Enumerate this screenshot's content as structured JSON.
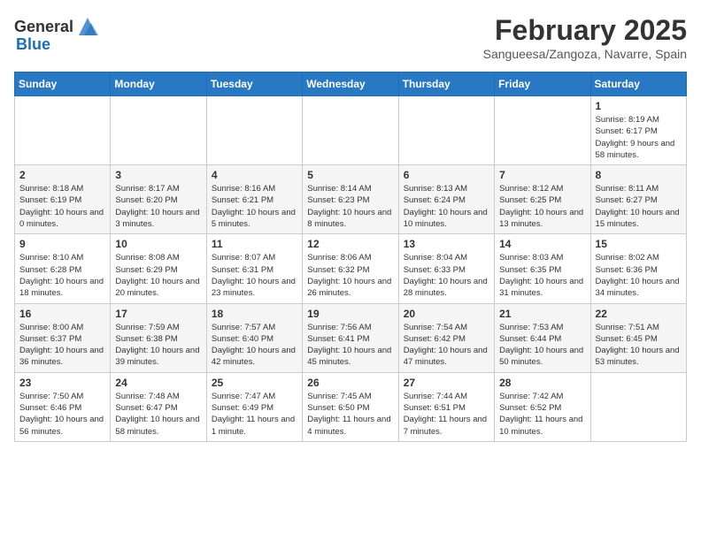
{
  "header": {
    "logo_general": "General",
    "logo_blue": "Blue",
    "title": "February 2025",
    "subtitle": "Sangueesa/Zangoza, Navarre, Spain"
  },
  "weekdays": [
    "Sunday",
    "Monday",
    "Tuesday",
    "Wednesday",
    "Thursday",
    "Friday",
    "Saturday"
  ],
  "weeks": [
    [
      {
        "day": "",
        "info": ""
      },
      {
        "day": "",
        "info": ""
      },
      {
        "day": "",
        "info": ""
      },
      {
        "day": "",
        "info": ""
      },
      {
        "day": "",
        "info": ""
      },
      {
        "day": "",
        "info": ""
      },
      {
        "day": "1",
        "info": "Sunrise: 8:19 AM\nSunset: 6:17 PM\nDaylight: 9 hours and 58 minutes."
      }
    ],
    [
      {
        "day": "2",
        "info": "Sunrise: 8:18 AM\nSunset: 6:19 PM\nDaylight: 10 hours and 0 minutes."
      },
      {
        "day": "3",
        "info": "Sunrise: 8:17 AM\nSunset: 6:20 PM\nDaylight: 10 hours and 3 minutes."
      },
      {
        "day": "4",
        "info": "Sunrise: 8:16 AM\nSunset: 6:21 PM\nDaylight: 10 hours and 5 minutes."
      },
      {
        "day": "5",
        "info": "Sunrise: 8:14 AM\nSunset: 6:23 PM\nDaylight: 10 hours and 8 minutes."
      },
      {
        "day": "6",
        "info": "Sunrise: 8:13 AM\nSunset: 6:24 PM\nDaylight: 10 hours and 10 minutes."
      },
      {
        "day": "7",
        "info": "Sunrise: 8:12 AM\nSunset: 6:25 PM\nDaylight: 10 hours and 13 minutes."
      },
      {
        "day": "8",
        "info": "Sunrise: 8:11 AM\nSunset: 6:27 PM\nDaylight: 10 hours and 15 minutes."
      }
    ],
    [
      {
        "day": "9",
        "info": "Sunrise: 8:10 AM\nSunset: 6:28 PM\nDaylight: 10 hours and 18 minutes."
      },
      {
        "day": "10",
        "info": "Sunrise: 8:08 AM\nSunset: 6:29 PM\nDaylight: 10 hours and 20 minutes."
      },
      {
        "day": "11",
        "info": "Sunrise: 8:07 AM\nSunset: 6:31 PM\nDaylight: 10 hours and 23 minutes."
      },
      {
        "day": "12",
        "info": "Sunrise: 8:06 AM\nSunset: 6:32 PM\nDaylight: 10 hours and 26 minutes."
      },
      {
        "day": "13",
        "info": "Sunrise: 8:04 AM\nSunset: 6:33 PM\nDaylight: 10 hours and 28 minutes."
      },
      {
        "day": "14",
        "info": "Sunrise: 8:03 AM\nSunset: 6:35 PM\nDaylight: 10 hours and 31 minutes."
      },
      {
        "day": "15",
        "info": "Sunrise: 8:02 AM\nSunset: 6:36 PM\nDaylight: 10 hours and 34 minutes."
      }
    ],
    [
      {
        "day": "16",
        "info": "Sunrise: 8:00 AM\nSunset: 6:37 PM\nDaylight: 10 hours and 36 minutes."
      },
      {
        "day": "17",
        "info": "Sunrise: 7:59 AM\nSunset: 6:38 PM\nDaylight: 10 hours and 39 minutes."
      },
      {
        "day": "18",
        "info": "Sunrise: 7:57 AM\nSunset: 6:40 PM\nDaylight: 10 hours and 42 minutes."
      },
      {
        "day": "19",
        "info": "Sunrise: 7:56 AM\nSunset: 6:41 PM\nDaylight: 10 hours and 45 minutes."
      },
      {
        "day": "20",
        "info": "Sunrise: 7:54 AM\nSunset: 6:42 PM\nDaylight: 10 hours and 47 minutes."
      },
      {
        "day": "21",
        "info": "Sunrise: 7:53 AM\nSunset: 6:44 PM\nDaylight: 10 hours and 50 minutes."
      },
      {
        "day": "22",
        "info": "Sunrise: 7:51 AM\nSunset: 6:45 PM\nDaylight: 10 hours and 53 minutes."
      }
    ],
    [
      {
        "day": "23",
        "info": "Sunrise: 7:50 AM\nSunset: 6:46 PM\nDaylight: 10 hours and 56 minutes."
      },
      {
        "day": "24",
        "info": "Sunrise: 7:48 AM\nSunset: 6:47 PM\nDaylight: 10 hours and 58 minutes."
      },
      {
        "day": "25",
        "info": "Sunrise: 7:47 AM\nSunset: 6:49 PM\nDaylight: 11 hours and 1 minute."
      },
      {
        "day": "26",
        "info": "Sunrise: 7:45 AM\nSunset: 6:50 PM\nDaylight: 11 hours and 4 minutes."
      },
      {
        "day": "27",
        "info": "Sunrise: 7:44 AM\nSunset: 6:51 PM\nDaylight: 11 hours and 7 minutes."
      },
      {
        "day": "28",
        "info": "Sunrise: 7:42 AM\nSunset: 6:52 PM\nDaylight: 11 hours and 10 minutes."
      },
      {
        "day": "",
        "info": ""
      }
    ]
  ]
}
